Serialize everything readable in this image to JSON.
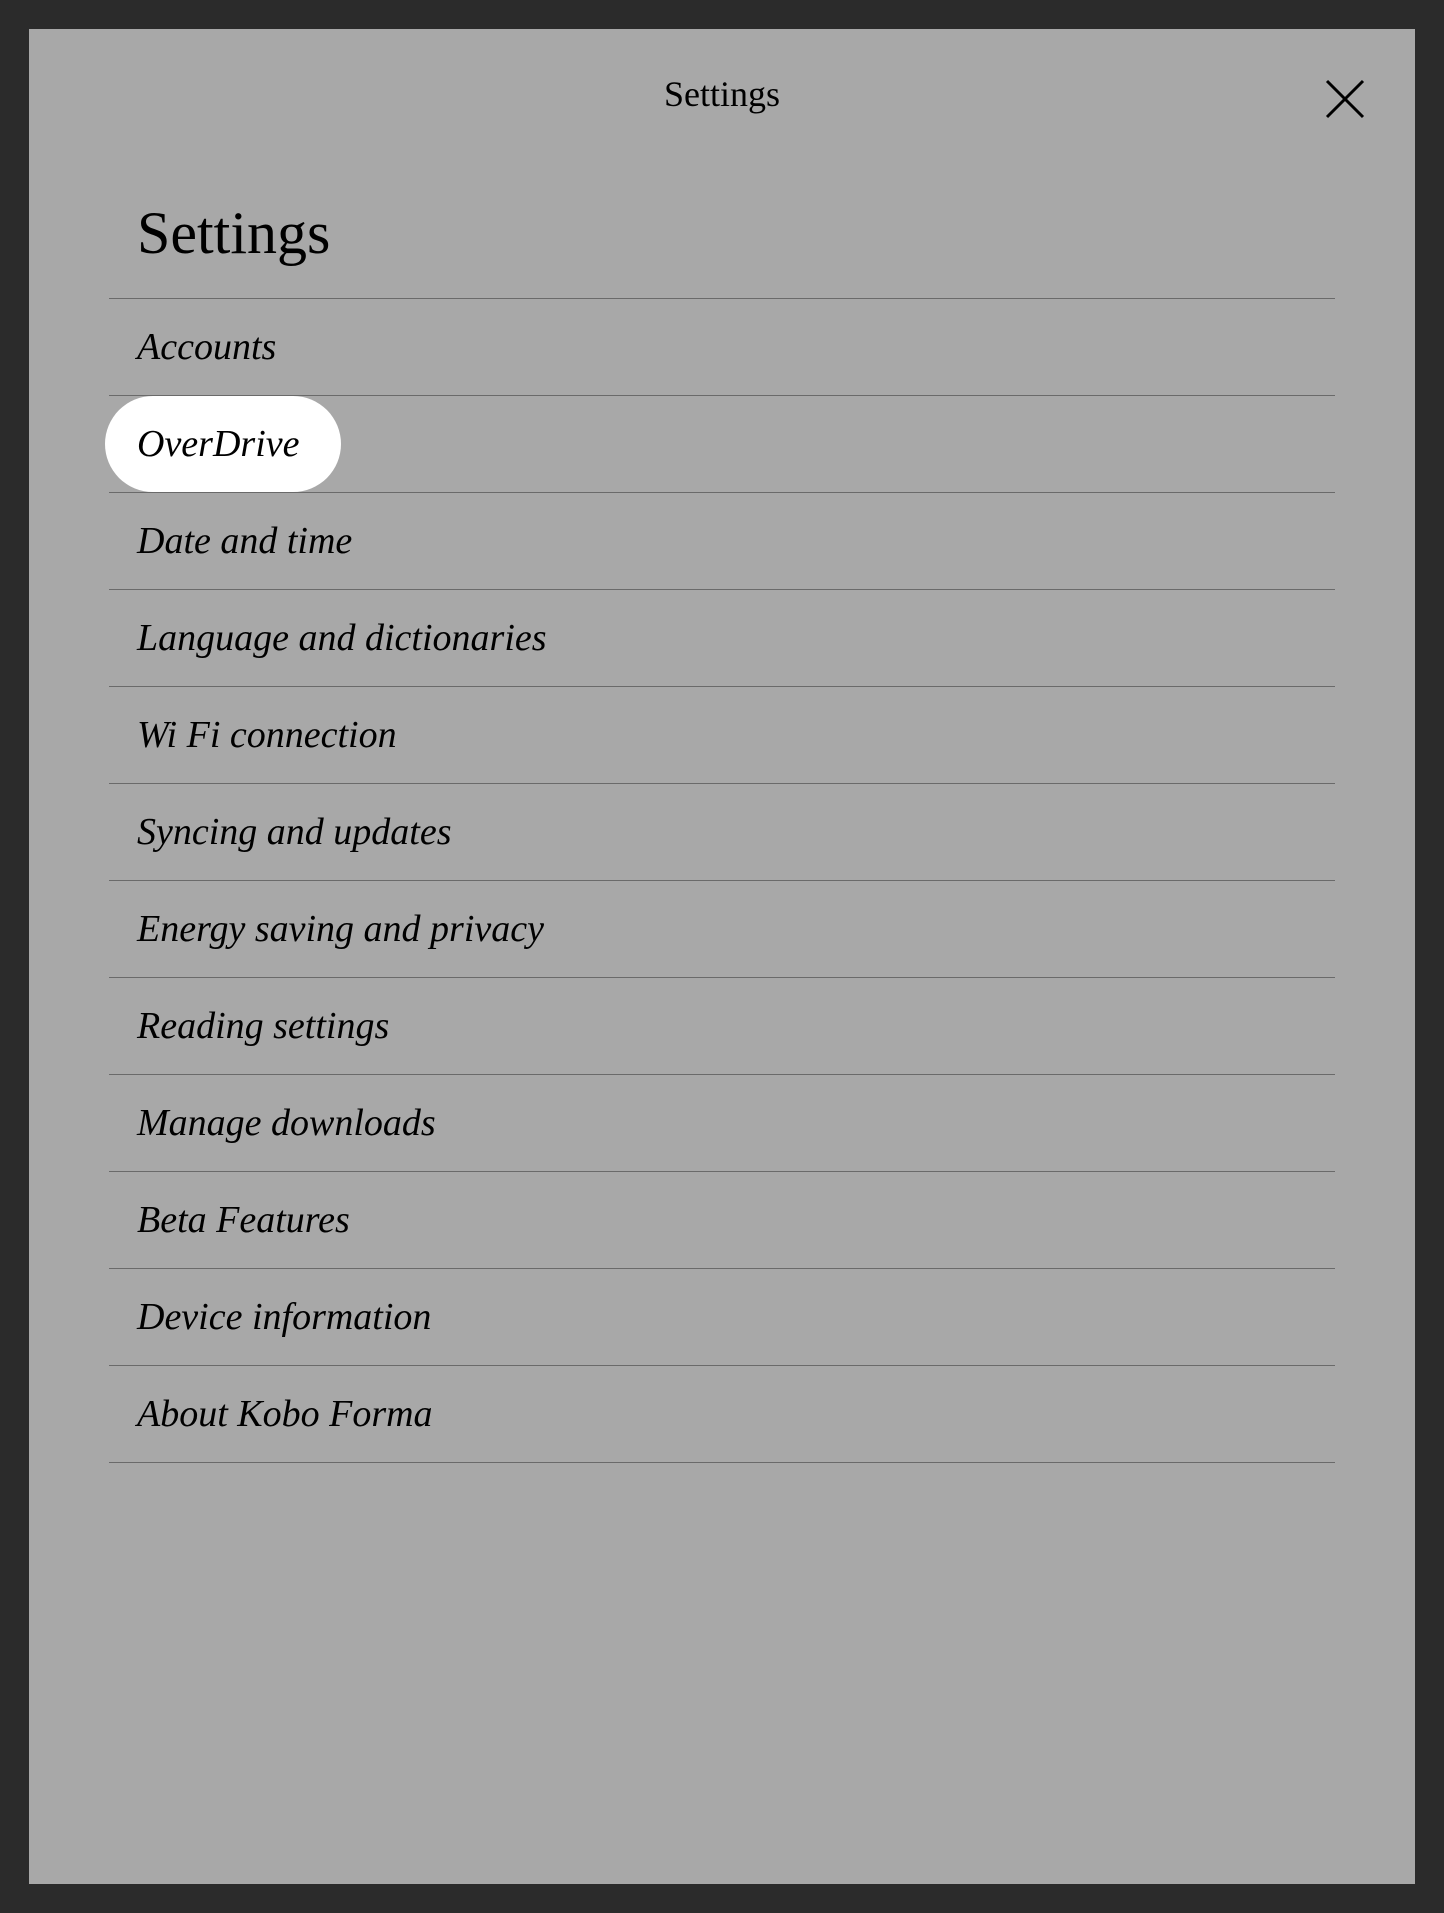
{
  "header": {
    "title": "Settings"
  },
  "page_title": "Settings",
  "items": [
    {
      "label": "Accounts",
      "highlighted": false
    },
    {
      "label": "OverDrive",
      "highlighted": true
    },
    {
      "label": "Date and time",
      "highlighted": false
    },
    {
      "label": "Language and dictionaries",
      "highlighted": false
    },
    {
      "label": "Wi Fi connection",
      "highlighted": false
    },
    {
      "label": "Syncing and updates",
      "highlighted": false
    },
    {
      "label": "Energy saving and privacy",
      "highlighted": false
    },
    {
      "label": "Reading settings",
      "highlighted": false
    },
    {
      "label": "Manage downloads",
      "highlighted": false
    },
    {
      "label": "Beta Features",
      "highlighted": false
    },
    {
      "label": "Device information",
      "highlighted": false
    },
    {
      "label": "About Kobo Forma",
      "highlighted": false
    }
  ]
}
